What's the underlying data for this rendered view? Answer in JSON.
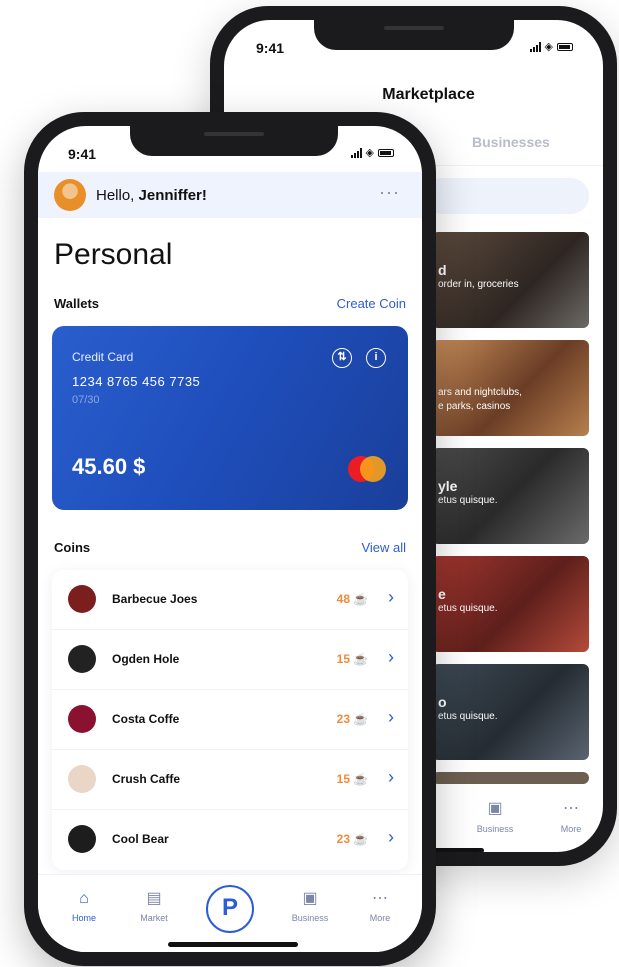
{
  "back_phone": {
    "time": "9:41",
    "title": "Marketplace",
    "tab_business": "Businesses",
    "tiles": [
      {
        "title": "d",
        "desc": "order in, groceries"
      },
      {
        "title": "",
        "desc": "ars and nightclubs,\ne parks, casinos"
      },
      {
        "title": "yle",
        "desc": "etus quisque."
      },
      {
        "title": "e",
        "desc": "etus quisque."
      },
      {
        "title": "o",
        "desc": "etus quisque."
      }
    ],
    "nav": {
      "business": "Business",
      "more": "More"
    }
  },
  "front_phone": {
    "time": "9:41",
    "greeting_prefix": "Hello, ",
    "user_name": "Jenniffer!",
    "more_glyph": "···",
    "heading": "Personal",
    "wallets_label": "Wallets",
    "create_coin": "Create Coin",
    "card": {
      "type": "Credit Card",
      "number": "1234 8765 456 7735",
      "expiry": "07/30",
      "balance": "45.60 $"
    },
    "coins_label": "Coins",
    "view_all": "View all",
    "coins": [
      {
        "name": "Barbecue Joes",
        "amount": "48",
        "logo_color": "#7b1e1e"
      },
      {
        "name": "Ogden Hole",
        "amount": "15",
        "logo_color": "#222222"
      },
      {
        "name": "Costa Coffe",
        "amount": "23",
        "logo_color": "#8a1230"
      },
      {
        "name": "Crush Caffe",
        "amount": "15",
        "logo_color": "#e9d6c6"
      },
      {
        "name": "Cool Bear",
        "amount": "23",
        "logo_color": "#1d1d1d"
      }
    ],
    "nav": {
      "home": "Home",
      "market": "Market",
      "center": "P",
      "business": "Business",
      "more": "More"
    }
  },
  "colors": {
    "accent": "#2b5ed4",
    "coin_amount": "#f08a3c",
    "card_gradient_start": "#2a5ecd"
  }
}
